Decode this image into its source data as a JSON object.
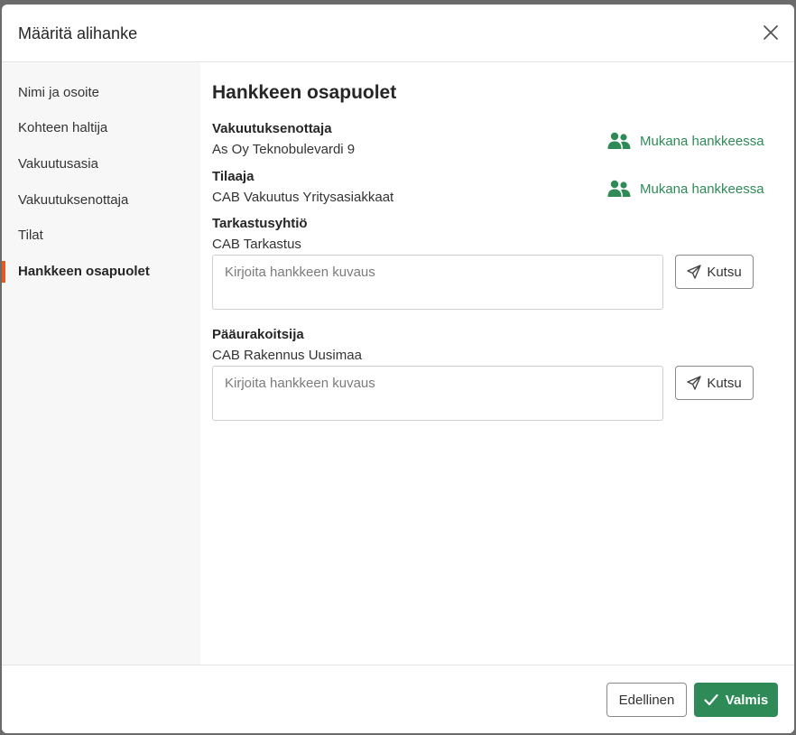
{
  "modal": {
    "title": "Määritä alihanke"
  },
  "sidebar": {
    "items": [
      {
        "label": "Nimi ja osoite"
      },
      {
        "label": "Kohteen haltija"
      },
      {
        "label": "Vakuutusasia"
      },
      {
        "label": "Vakuutuksenottaja"
      },
      {
        "label": "Tilat"
      },
      {
        "label": "Hankkeen osapuolet"
      }
    ],
    "active_index": 5
  },
  "main": {
    "title": "Hankkeen osapuolet",
    "parties": [
      {
        "label": "Vakuutuksenottaja",
        "value": "As Oy Teknobulevardi 9",
        "status": "Mukana hankkeessa"
      },
      {
        "label": "Tilaaja",
        "value": "CAB Vakuutus Yritysasiakkaat",
        "status": "Mukana hankkeessa"
      },
      {
        "label": "Tarkastusyhtiö",
        "value": "CAB Tarkastus",
        "placeholder": "Kirjoita hankkeen kuvaus",
        "invite_label": "Kutsu"
      },
      {
        "label": "Pääurakoitsija",
        "value": "CAB Rakennus Uusimaa",
        "placeholder": "Kirjoita hankkeen kuvaus",
        "invite_label": "Kutsu"
      }
    ]
  },
  "footer": {
    "prev_label": "Edellinen",
    "done_label": "Valmis"
  },
  "colors": {
    "accent": "#2e8b57",
    "active_indicator": "#e8571d"
  }
}
